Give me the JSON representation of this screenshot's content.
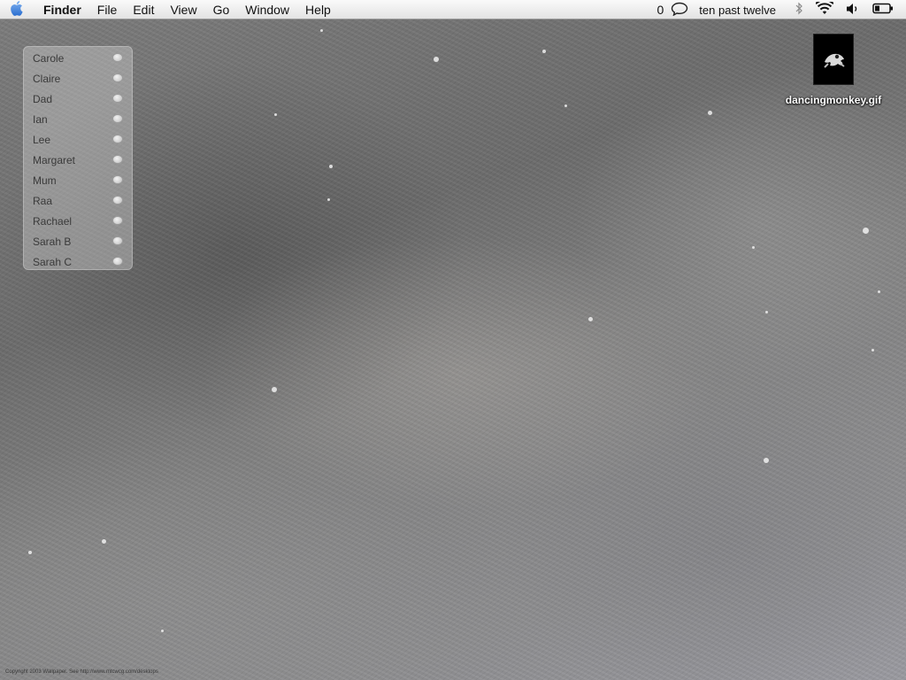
{
  "menubar": {
    "apple_icon": "apple-logo-icon",
    "app_name": "Finder",
    "menus": [
      "File",
      "Edit",
      "View",
      "Go",
      "Window",
      "Help"
    ],
    "status": {
      "chat_count": "0",
      "chat_icon": "speech-bubble-icon",
      "clock": "ten past twelve",
      "bluetooth_icon": "bluetooth-icon",
      "wifi_icon": "wifi-icon",
      "volume_icon": "volume-icon",
      "battery_icon": "battery-icon"
    }
  },
  "buddy_list": {
    "buddies": [
      {
        "name": "Carole"
      },
      {
        "name": "Claire"
      },
      {
        "name": "Dad"
      },
      {
        "name": "Ian"
      },
      {
        "name": "Lee"
      },
      {
        "name": "Margaret"
      },
      {
        "name": "Mum"
      },
      {
        "name": "Raa"
      },
      {
        "name": "Rachael"
      },
      {
        "name": "Sarah B"
      },
      {
        "name": "Sarah C"
      }
    ]
  },
  "desktop": {
    "file_icon_label": "dancingmonkey.gif",
    "credit_text": "Copyright 2003 Wallpaper. See http://www.mtcwcg.com/desktops"
  },
  "colors": {
    "menubar_top": "#fafafa",
    "menubar_bottom": "#e3e3e3",
    "apple_blue": "#3d83e0"
  }
}
